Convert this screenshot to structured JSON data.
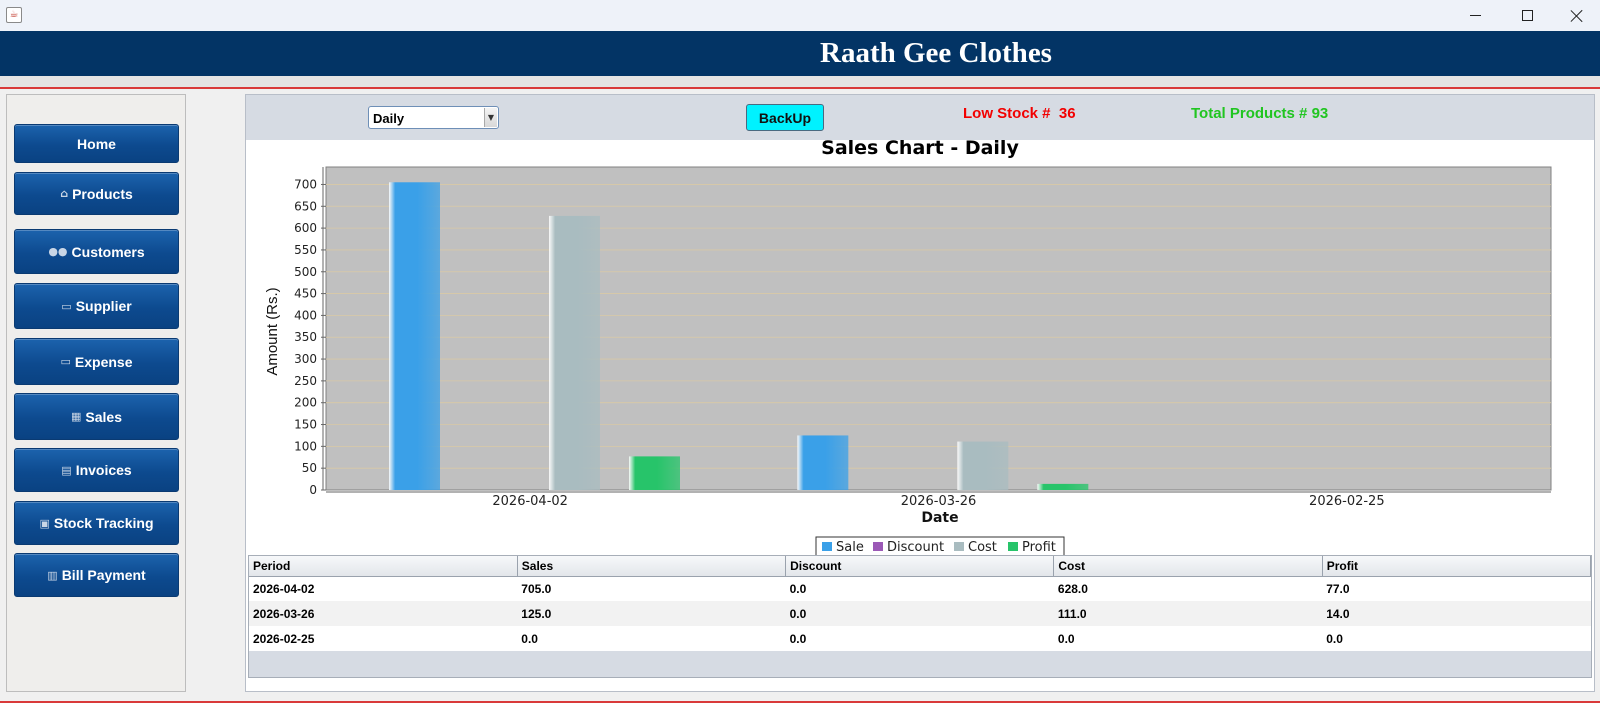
{
  "window": {
    "app_icon": "java-icon"
  },
  "header": {
    "title": "Raath Gee Clothes"
  },
  "sidebar": {
    "items": [
      {
        "label": "Home",
        "icon": ""
      },
      {
        "label": "Products",
        "icon": "box-icon"
      },
      {
        "label": "Customers",
        "icon": "users-icon"
      },
      {
        "label": "Supplier",
        "icon": "truck-icon"
      },
      {
        "label": "Expense",
        "icon": "truck-icon"
      },
      {
        "label": "Sales",
        "icon": "calculator-icon"
      },
      {
        "label": "Invoices",
        "icon": "money-icon"
      },
      {
        "label": "Stock Tracking",
        "icon": "clipboard-icon"
      },
      {
        "label": "Bill Payment",
        "icon": "receipt-icon"
      }
    ]
  },
  "toolbar": {
    "period_select": "Daily",
    "backup_label": "BackUp",
    "low_stock": "Low Stock #  36",
    "total_products": "Total Products # 93"
  },
  "colors": {
    "header_bg": "#033465",
    "nav_button": "#0d4a8f",
    "backup_button": "#00f2ff",
    "low_stock_text": "#f20000",
    "total_products_text": "#21c521"
  },
  "chart_data": {
    "type": "bar",
    "title": "Sales Chart - Daily",
    "xlabel": "Date",
    "ylabel": "Amount (Rs.)",
    "categories": [
      "2026-04-02",
      "2026-03-26",
      "2026-02-25"
    ],
    "series": [
      {
        "name": "Sale",
        "color": "#3aa0e8",
        "values": [
          705,
          125,
          0
        ]
      },
      {
        "name": "Discount",
        "color": "#9b59b6",
        "values": [
          0,
          0,
          0
        ]
      },
      {
        "name": "Cost",
        "color": "#a9bcc0",
        "values": [
          628,
          111,
          0
        ]
      },
      {
        "name": "Profit",
        "color": "#27c46a",
        "values": [
          77,
          14,
          0
        ]
      }
    ],
    "ylim": [
      0,
      740
    ],
    "yticks": [
      0,
      50,
      100,
      150,
      200,
      250,
      300,
      350,
      400,
      450,
      500,
      550,
      600,
      650,
      700
    ],
    "grid": true,
    "legend": "bottom-center"
  },
  "table": {
    "columns": [
      "Period",
      "Sales",
      "Discount",
      "Cost",
      "Profit"
    ],
    "rows": [
      [
        "2026-04-02",
        "705.0",
        "0.0",
        "628.0",
        "77.0"
      ],
      [
        "2026-03-26",
        "125.0",
        "0.0",
        "111.0",
        "14.0"
      ],
      [
        "2026-02-25",
        "0.0",
        "0.0",
        "0.0",
        "0.0"
      ]
    ]
  }
}
